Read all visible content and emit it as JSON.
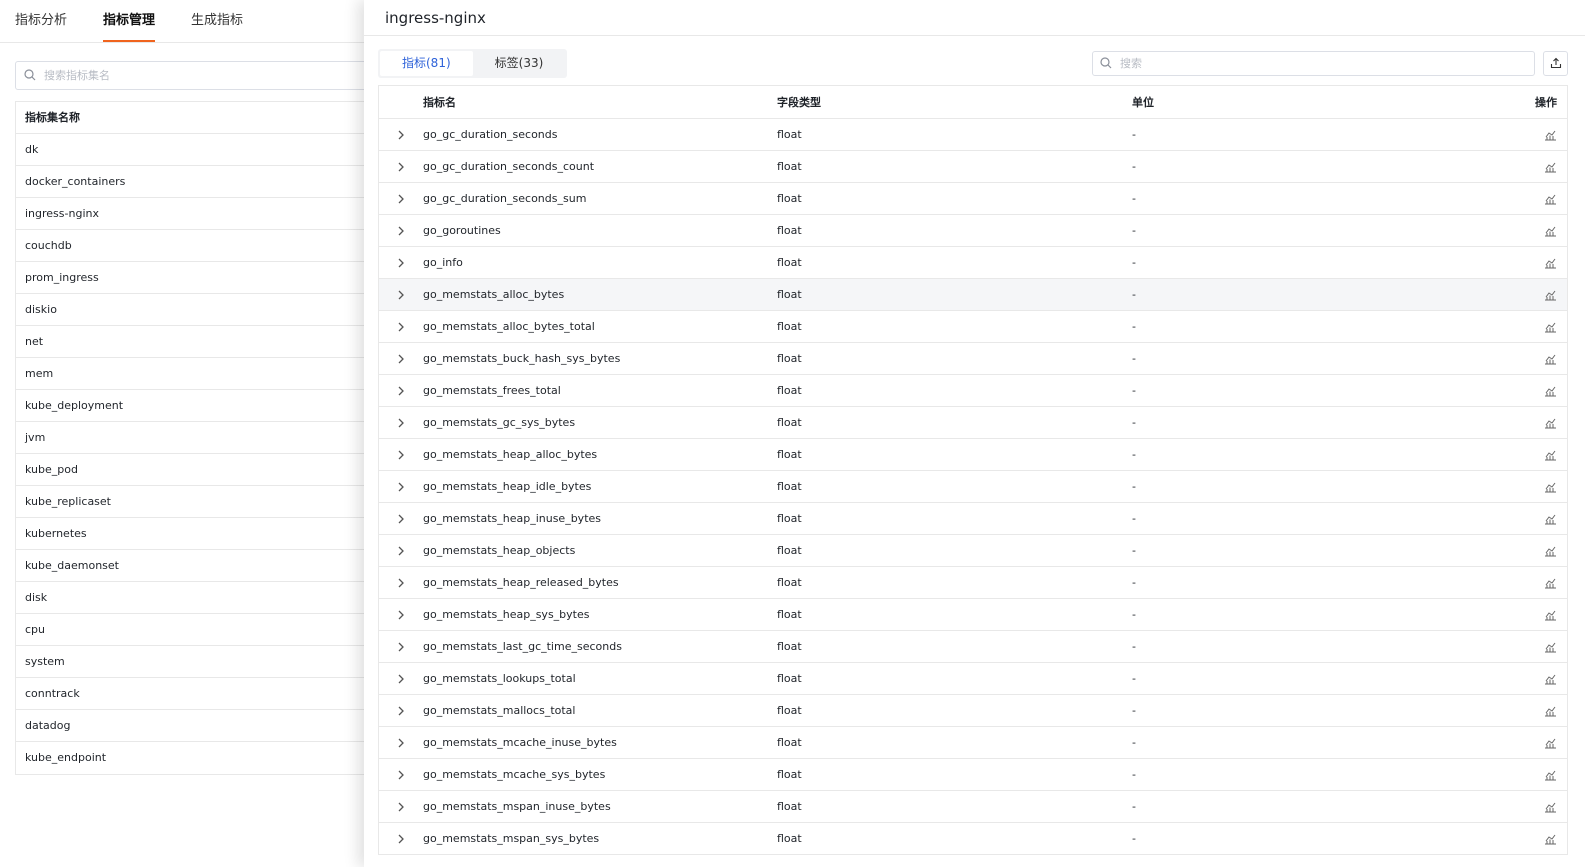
{
  "top_tabs": [
    {
      "label": "指标分析",
      "active": false
    },
    {
      "label": "指标管理",
      "active": true
    },
    {
      "label": "生成指标",
      "active": false
    }
  ],
  "left": {
    "search_placeholder": "搜索指标集名",
    "table_header": "指标集名称",
    "sets": [
      "dk",
      "docker_containers",
      "ingress-nginx",
      "couchdb",
      "prom_ingress",
      "diskio",
      "net",
      "mem",
      "kube_deployment",
      "jvm",
      "kube_pod",
      "kube_replicaset",
      "kubernetes",
      "kube_daemonset",
      "disk",
      "cpu",
      "system",
      "conntrack",
      "datadog",
      "kube_endpoint"
    ]
  },
  "drawer": {
    "title": "ingress-nginx",
    "tabs": [
      {
        "label": "指标(81)",
        "active": true
      },
      {
        "label": "标签(33)",
        "active": false
      }
    ],
    "search_placeholder": "搜索",
    "columns": {
      "name": "指标名",
      "type": "字段类型",
      "unit": "单位",
      "op": "操作"
    },
    "rows": [
      {
        "name": "go_gc_duration_seconds",
        "type": "float",
        "unit": "-"
      },
      {
        "name": "go_gc_duration_seconds_count",
        "type": "float",
        "unit": "-"
      },
      {
        "name": "go_gc_duration_seconds_sum",
        "type": "float",
        "unit": "-"
      },
      {
        "name": "go_goroutines",
        "type": "float",
        "unit": "-"
      },
      {
        "name": "go_info",
        "type": "float",
        "unit": "-"
      },
      {
        "name": "go_memstats_alloc_bytes",
        "type": "float",
        "unit": "-",
        "hover": true
      },
      {
        "name": "go_memstats_alloc_bytes_total",
        "type": "float",
        "unit": "-"
      },
      {
        "name": "go_memstats_buck_hash_sys_bytes",
        "type": "float",
        "unit": "-"
      },
      {
        "name": "go_memstats_frees_total",
        "type": "float",
        "unit": "-"
      },
      {
        "name": "go_memstats_gc_sys_bytes",
        "type": "float",
        "unit": "-"
      },
      {
        "name": "go_memstats_heap_alloc_bytes",
        "type": "float",
        "unit": "-"
      },
      {
        "name": "go_memstats_heap_idle_bytes",
        "type": "float",
        "unit": "-"
      },
      {
        "name": "go_memstats_heap_inuse_bytes",
        "type": "float",
        "unit": "-"
      },
      {
        "name": "go_memstats_heap_objects",
        "type": "float",
        "unit": "-"
      },
      {
        "name": "go_memstats_heap_released_bytes",
        "type": "float",
        "unit": "-"
      },
      {
        "name": "go_memstats_heap_sys_bytes",
        "type": "float",
        "unit": "-"
      },
      {
        "name": "go_memstats_last_gc_time_seconds",
        "type": "float",
        "unit": "-"
      },
      {
        "name": "go_memstats_lookups_total",
        "type": "float",
        "unit": "-"
      },
      {
        "name": "go_memstats_mallocs_total",
        "type": "float",
        "unit": "-"
      },
      {
        "name": "go_memstats_mcache_inuse_bytes",
        "type": "float",
        "unit": "-"
      },
      {
        "name": "go_memstats_mcache_sys_bytes",
        "type": "float",
        "unit": "-"
      },
      {
        "name": "go_memstats_mspan_inuse_bytes",
        "type": "float",
        "unit": "-"
      },
      {
        "name": "go_memstats_mspan_sys_bytes",
        "type": "float",
        "unit": "-"
      }
    ]
  },
  "colors": {
    "accent": "#f0641e",
    "tab_active": "#2e62d9",
    "border": "#e8e8e8"
  },
  "icons": {
    "search": "search-icon",
    "export": "export-icon",
    "expand": "chevron-right-icon",
    "chart": "chart-icon"
  }
}
